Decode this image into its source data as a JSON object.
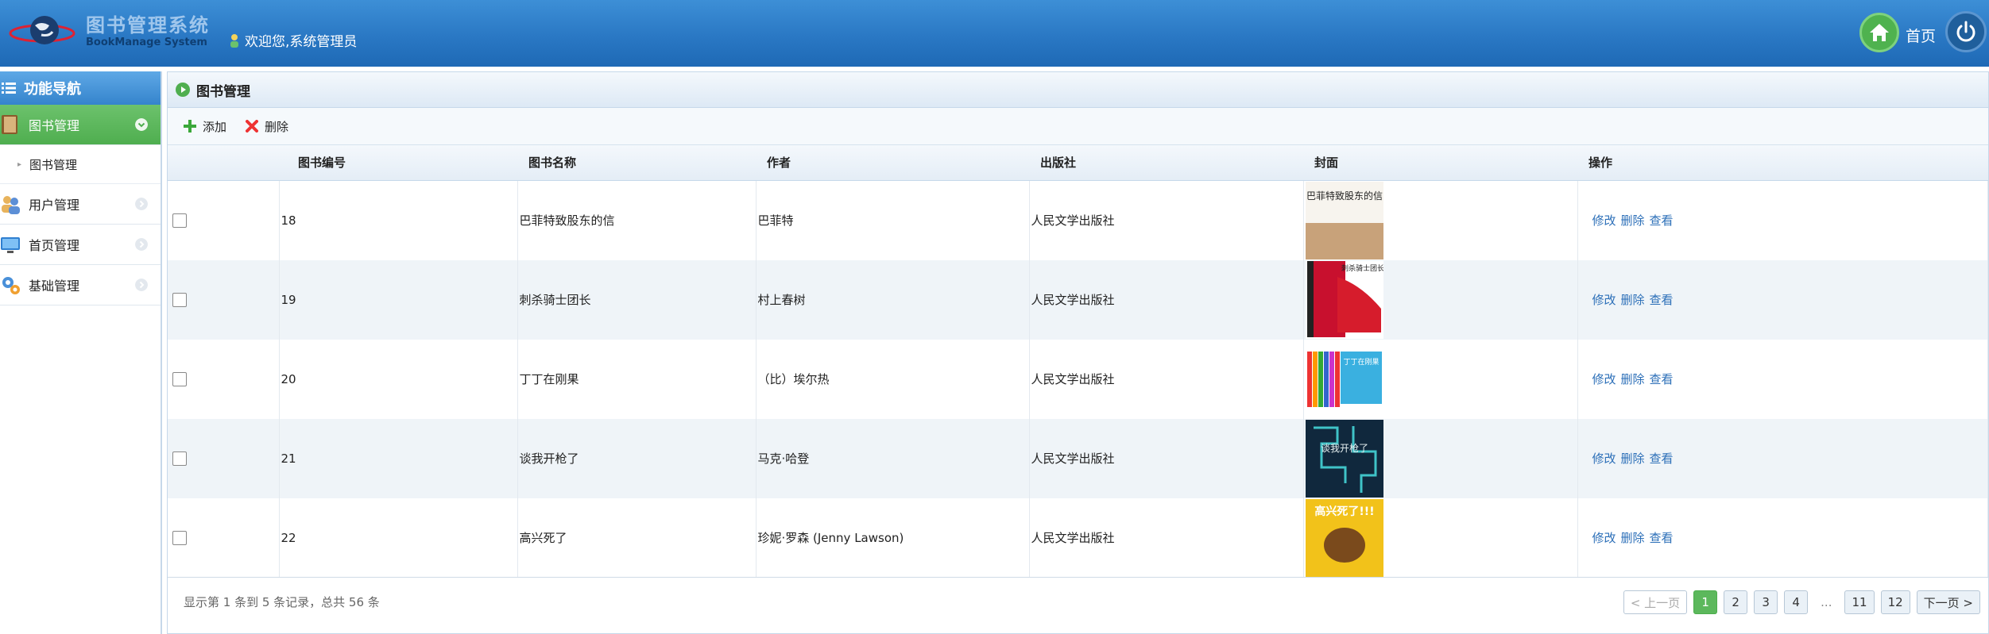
{
  "header": {
    "logo_title": "图书管理系统",
    "logo_subtitle": "BookManage System",
    "welcome": "欢迎您,系统管理员",
    "home_label": "首页"
  },
  "sidebar": {
    "title": "功能导航",
    "items": [
      {
        "label": "图书管理",
        "active": true,
        "sub": [
          {
            "label": "图书管理"
          }
        ]
      },
      {
        "label": "用户管理",
        "active": false
      },
      {
        "label": "首页管理",
        "active": false
      },
      {
        "label": "基础管理",
        "active": false
      }
    ]
  },
  "main": {
    "title": "图书管理",
    "toolbar": {
      "add": "添加",
      "delete": "删除"
    },
    "columns": [
      "图书编号",
      "图书名称",
      "作者",
      "出版社",
      "封面",
      "操作"
    ],
    "rows": [
      {
        "id": "18",
        "name": "巴菲特致股东的信",
        "author": "巴菲特",
        "publisher": "人民文学出版社",
        "cover_text": "巴菲特致股东的信",
        "ops": [
          "修改",
          "删除",
          "查看"
        ]
      },
      {
        "id": "19",
        "name": "刺杀骑士团长",
        "author": "村上春树",
        "publisher": "人民文学出版社",
        "cover_text": "刺杀骑士团长",
        "ops": [
          "修改",
          "删除",
          "查看"
        ]
      },
      {
        "id": "20",
        "name": "丁丁在刚果",
        "author": "（比）埃尔热",
        "publisher": "人民文学出版社",
        "cover_text": "丁丁在刚果",
        "ops": [
          "修改",
          "删除",
          "查看"
        ]
      },
      {
        "id": "21",
        "name": "谈我开枪了",
        "author": "马克·哈登",
        "publisher": "人民文学出版社",
        "cover_text": "谈我开枪了",
        "ops": [
          "修改",
          "删除",
          "查看"
        ]
      },
      {
        "id": "22",
        "name": "高兴死了",
        "author": "珍妮·罗森 (Jenny Lawson)",
        "publisher": "人民文学出版社",
        "cover_text": "高兴死了!!!",
        "ops": [
          "修改",
          "删除",
          "查看"
        ]
      }
    ],
    "pager": {
      "info": "显示第 1 条到 5 条记录，总共 56 条",
      "prev": "< 上一页",
      "pages": [
        "1",
        "2",
        "3",
        "4",
        "...",
        "11",
        "12"
      ],
      "current": "1",
      "next": "下一页 >"
    }
  },
  "colors": {
    "header_blue": "#2a78c4",
    "active_green": "#5cb85c",
    "link_blue": "#2c6fb8"
  }
}
